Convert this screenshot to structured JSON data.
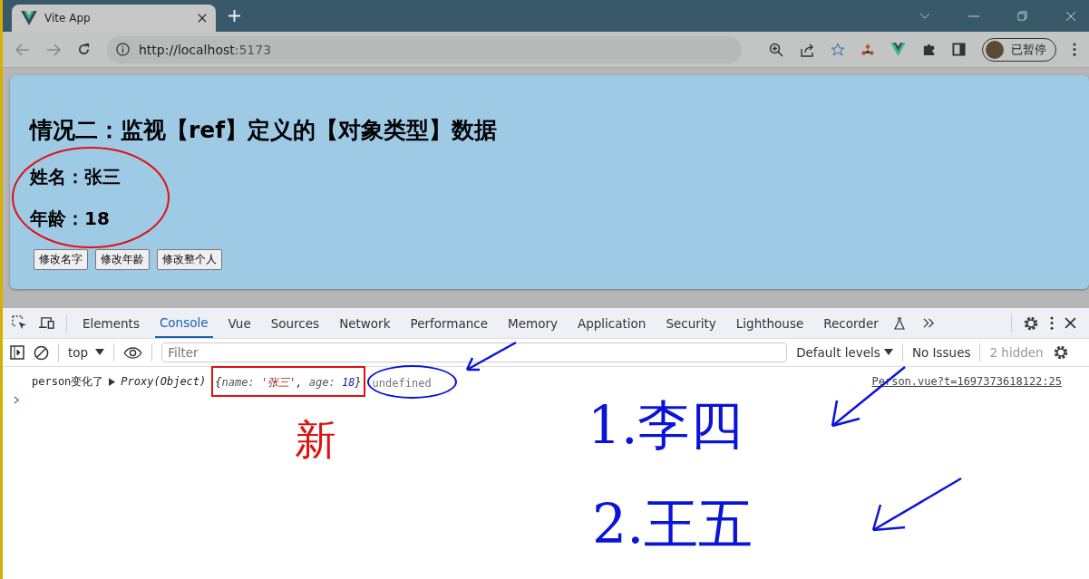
{
  "browser": {
    "tab": {
      "title": "Vite App"
    },
    "url": {
      "host": "http://localhost",
      "port": ":5173"
    },
    "profile": {
      "label": "已暂停"
    }
  },
  "page": {
    "title": "情况二：监视【ref】定义的【对象类型】数据",
    "fields": [
      "姓名：张三",
      "年龄：18"
    ],
    "buttons": [
      "修改名字",
      "修改年龄",
      "修改整个人"
    ]
  },
  "devtools": {
    "tabs": [
      {
        "label": "Elements",
        "selected": false
      },
      {
        "label": "Console",
        "selected": true
      },
      {
        "label": "Vue",
        "selected": false
      },
      {
        "label": "Sources",
        "selected": false
      },
      {
        "label": "Network",
        "selected": false
      },
      {
        "label": "Performance",
        "selected": false
      },
      {
        "label": "Memory",
        "selected": false
      },
      {
        "label": "Application",
        "selected": false
      },
      {
        "label": "Security",
        "selected": false
      },
      {
        "label": "Lighthouse",
        "selected": false
      },
      {
        "label": "Recorder",
        "selected": false
      }
    ],
    "context": "top",
    "filter": {
      "placeholder": "Filter"
    },
    "levels": "Default levels",
    "issues": "No Issues",
    "hidden": "2 hidden",
    "log": {
      "message": "person变化了",
      "preview": "Proxy(Object)",
      "object": [
        {
          "kind": "punct",
          "text": "{"
        },
        {
          "kind": "key",
          "text": "name: "
        },
        {
          "kind": "string",
          "text": "'张三'"
        },
        {
          "kind": "punct",
          "text": ", "
        },
        {
          "kind": "key",
          "text": "age: "
        },
        {
          "kind": "number",
          "text": "18"
        },
        {
          "kind": "punct",
          "text": "}"
        }
      ],
      "result": "undefined",
      "source": "Person.vue?t=1697373618122:25"
    }
  },
  "annotations": [
    {
      "text": "新",
      "color": "#e01010"
    },
    {
      "text": "1.李四",
      "color": "#0a14d8"
    },
    {
      "text": "2.王五",
      "color": "#0a14d8"
    }
  ]
}
